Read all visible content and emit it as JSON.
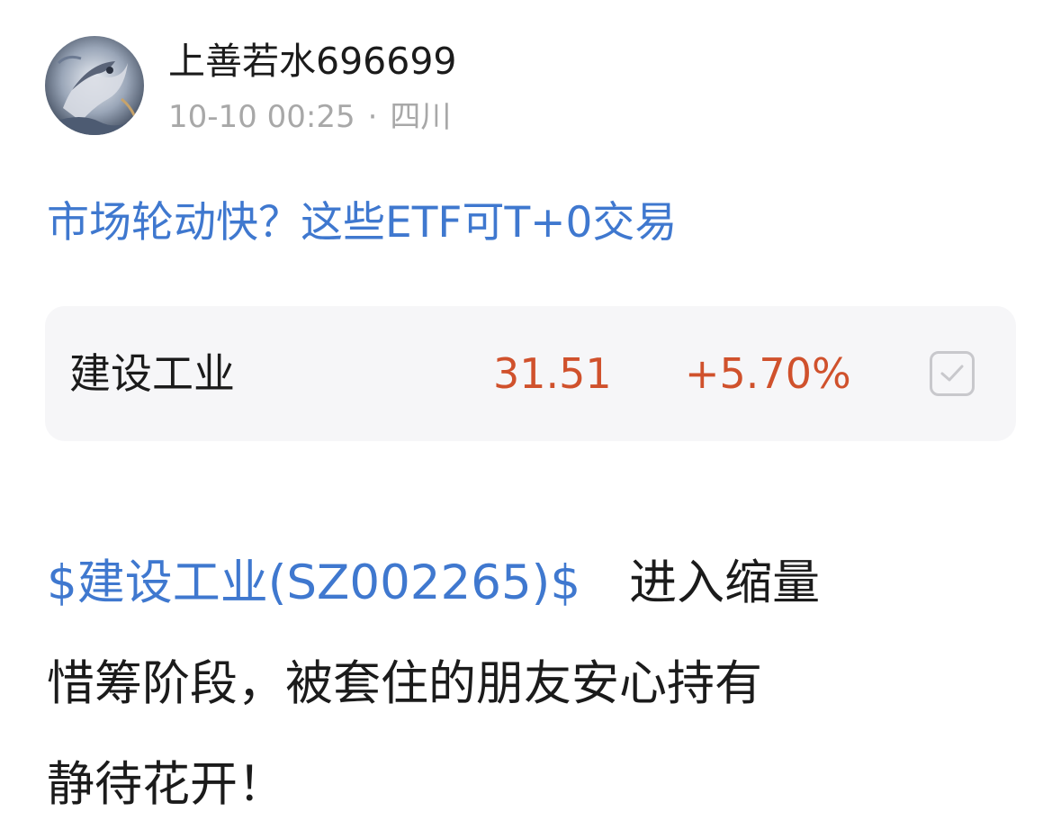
{
  "post": {
    "author": {
      "name": "上善若水696699",
      "avatar_icon": "dragon-avatar-icon"
    },
    "time": "10-10 00:25",
    "separator": "·",
    "location": "四川",
    "topic_link": "市场轮动快？这些ETF可T+0交易",
    "stock_card": {
      "name": "建设工业",
      "price": "31.51",
      "change": "+5.70%",
      "check_icon": "checkbox-check-icon",
      "color_up": "#d0512c"
    },
    "body": {
      "cashtag": "$建设工业(SZ002265)$",
      "line1_text": "进入缩量",
      "line2_text": "惜筹阶段，被套住的朋友安心持有",
      "line3_text": "静待花开！"
    }
  },
  "colors": {
    "link": "#3f78cf",
    "text": "#1b1b1b",
    "meta": "#a8a8a8",
    "card_bg": "#f6f6f8"
  }
}
